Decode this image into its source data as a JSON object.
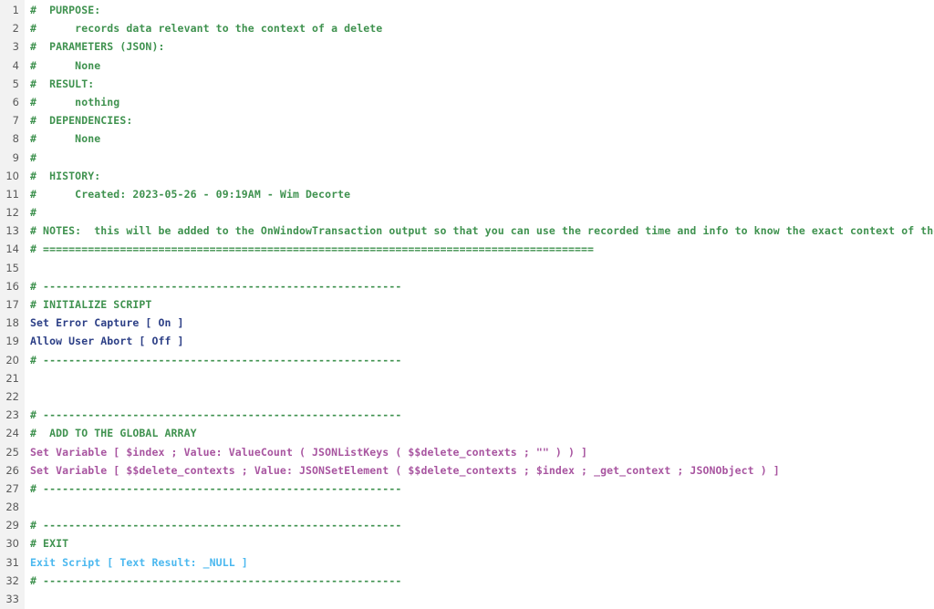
{
  "editor": {
    "name": "filemaker-script-editor",
    "gutter_label": "line-numbers",
    "colors": {
      "background": "#ffffff",
      "gutter_background": "#f2f2f2",
      "line_number": "#5b5b5b",
      "comment": "#3f924f",
      "script_step": "#2c3f86",
      "exit_script": "#4bb8ef",
      "set_variable": "#a855a0"
    }
  },
  "lines": [
    {
      "number": "1",
      "text": "#  PURPOSE:",
      "token": "comment"
    },
    {
      "number": "2",
      "text": "#      records data relevant to the context of a delete",
      "token": "comment"
    },
    {
      "number": "3",
      "text": "#  PARAMETERS (JSON):",
      "token": "comment"
    },
    {
      "number": "4",
      "text": "#      None",
      "token": "comment"
    },
    {
      "number": "5",
      "text": "#  RESULT:",
      "token": "comment"
    },
    {
      "number": "6",
      "text": "#      nothing",
      "token": "comment"
    },
    {
      "number": "7",
      "text": "#  DEPENDENCIES:",
      "token": "comment"
    },
    {
      "number": "8",
      "text": "#      None",
      "token": "comment"
    },
    {
      "number": "9",
      "text": "#",
      "token": "comment"
    },
    {
      "number": "10",
      "text": "#  HISTORY:",
      "token": "comment"
    },
    {
      "number": "11",
      "text": "#      Created: 2023-05-26 - 09:19AM - Wim Decorte",
      "token": "comment"
    },
    {
      "number": "12",
      "text": "#",
      "token": "comment"
    },
    {
      "number": "13",
      "text": "# NOTES:  this will be added to the OnWindowTransaction output so that you can use the recorded time and info to know the exact context of the deletes",
      "token": "comment"
    },
    {
      "number": "14",
      "text": "# ======================================================================================",
      "token": "comment"
    },
    {
      "number": "15",
      "text": "",
      "token": "none"
    },
    {
      "number": "16",
      "text": "# --------------------------------------------------------",
      "token": "comment"
    },
    {
      "number": "17",
      "text": "# INITIALIZE SCRIPT",
      "token": "comment"
    },
    {
      "number": "18",
      "text": "Set Error Capture [ On ]",
      "token": "step"
    },
    {
      "number": "19",
      "text": "Allow User Abort [ Off ]",
      "token": "step"
    },
    {
      "number": "20",
      "text": "# --------------------------------------------------------",
      "token": "comment"
    },
    {
      "number": "21",
      "text": "",
      "token": "none"
    },
    {
      "number": "22",
      "text": "",
      "token": "none"
    },
    {
      "number": "23",
      "text": "# --------------------------------------------------------",
      "token": "comment"
    },
    {
      "number": "24",
      "text": "#  ADD TO THE GLOBAL ARRAY",
      "token": "comment"
    },
    {
      "number": "25",
      "text": "Set Variable [ $index ; Value: ValueCount ( JSONListKeys ( $$delete_contexts ; \"\" ) ) ]",
      "token": "setvar"
    },
    {
      "number": "26",
      "text": "Set Variable [ $$delete_contexts ; Value: JSONSetElement ( $$delete_contexts ; $index ; _get_context ; JSONObject ) ]",
      "token": "setvar"
    },
    {
      "number": "27",
      "text": "# --------------------------------------------------------",
      "token": "comment"
    },
    {
      "number": "28",
      "text": "",
      "token": "none"
    },
    {
      "number": "29",
      "text": "# --------------------------------------------------------",
      "token": "comment"
    },
    {
      "number": "30",
      "text": "# EXIT",
      "token": "comment"
    },
    {
      "number": "31",
      "text": "Exit Script [ Text Result: _NULL ]",
      "token": "exit"
    },
    {
      "number": "32",
      "text": "# --------------------------------------------------------",
      "token": "comment"
    },
    {
      "number": "33",
      "text": "",
      "token": "none"
    }
  ]
}
